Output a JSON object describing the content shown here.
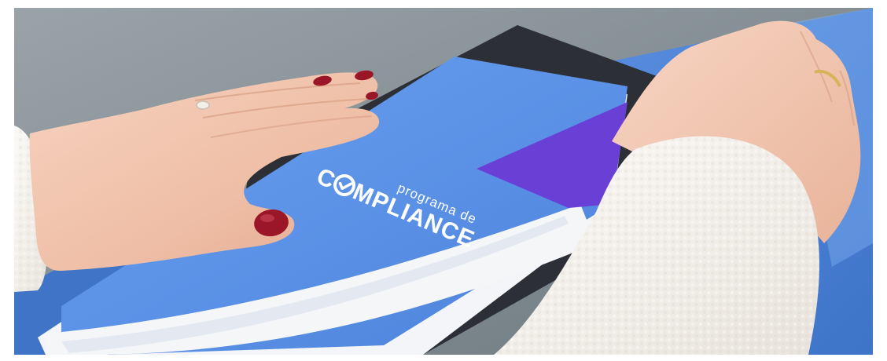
{
  "photo": {
    "subject_logo": {
      "small_text": "programa de",
      "big_prefix": "C",
      "big_suffix": "MPLIANCE"
    }
  },
  "colors": {
    "background_gray": "#7e8a92",
    "table_blue": "#4f86d9",
    "folder_blue": "#5c93e6",
    "folder_purple": "#6a3fd6",
    "folder_edge_white": "#f2f4f7",
    "clipboard_dark": "#2b2f35",
    "skin": "#f1c3ad",
    "nail_polish": "#9b1627",
    "sweater_white": "#f4f1ec"
  }
}
